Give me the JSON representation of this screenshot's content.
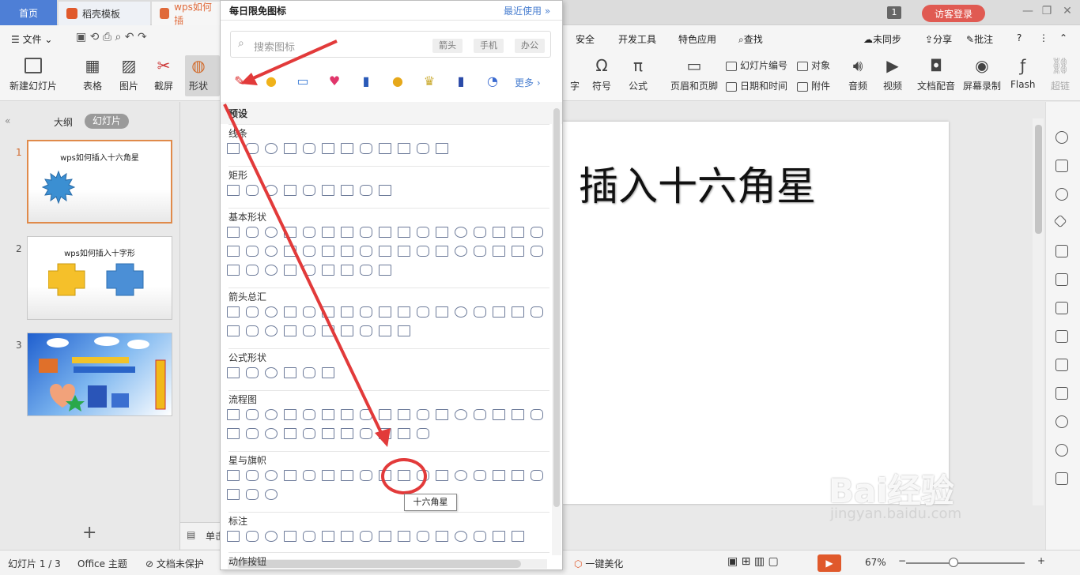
{
  "tabs": {
    "home": "首页",
    "template": "稻壳模板",
    "doc": "wps如何插"
  },
  "window": {
    "badge": "1",
    "login": "访客登录"
  },
  "menu": {
    "file": "文件",
    "security": "安全",
    "dev": "开发工具",
    "special": "特色应用",
    "search": "查找",
    "unsync": "未同步",
    "share": "分享",
    "comment": "批注"
  },
  "ribbon": {
    "new_slide": "新建幻灯片",
    "table": "表格",
    "image": "图片",
    "screenshot": "截屏",
    "shape": "形状",
    "char": "字",
    "symbol": "符号",
    "formula": "公式",
    "header_footer": "页眉和页脚",
    "slide_number": "幻灯片编号",
    "object": "对象",
    "datetime": "日期和时间",
    "attachment": "附件",
    "audio": "音频",
    "video": "视频",
    "voiceover": "文档配音",
    "screen_record": "屏幕录制",
    "flash": "Flash",
    "hyperlink": "超链"
  },
  "left_panel": {
    "outline_tab": "大纲",
    "slides_tab": "幻灯片",
    "slides": [
      {
        "num": "1",
        "title": "wps如何插入十六角星"
      },
      {
        "num": "2",
        "title": "wps如何插入十字形"
      },
      {
        "num": "3",
        "title": ""
      }
    ]
  },
  "slide": {
    "title": "插入十六角星"
  },
  "notes_label": "单击",
  "shape_panel": {
    "title": "每日限免图标",
    "recent": "最近使用",
    "search_placeholder": "搜索图标",
    "chips": [
      "箭头",
      "手机",
      "办公"
    ],
    "more": "更多",
    "preset": "预设",
    "categories": [
      "线条",
      "矩形",
      "基本形状",
      "箭头总汇",
      "公式形状",
      "流程图",
      "星与旗帜",
      "标注",
      "动作按钮"
    ],
    "tooltip": "十六角星"
  },
  "status": {
    "slide_pos": "幻灯片 1 / 3",
    "theme": "Office 主题",
    "protect": "文档未保护",
    "beautify": "一键美化",
    "zoom": "67%"
  },
  "watermark": {
    "brand": "Bai经验",
    "url": "jingyan.baidu.com"
  },
  "colors": {
    "accent": "#4e7fd6",
    "annotation": "#e23a3a",
    "login": "#e05a52"
  }
}
